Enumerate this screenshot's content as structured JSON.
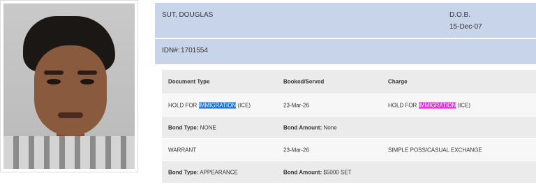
{
  "person": {
    "name": "SUT, DOUGLAS",
    "dob_label": "D.O.B.",
    "dob_value": "15-Dec-07",
    "idn_label": "IDN#:",
    "idn_value": "1701554"
  },
  "table": {
    "headers": {
      "doc_type": "Document Type",
      "booked": "Booked/Served",
      "charge": "Charge"
    },
    "records": [
      {
        "doc_pre": "HOLD FOR ",
        "doc_hl": "IMMIGRATION",
        "doc_post": " (ICE)",
        "booked": "23-Mar-26",
        "charge_pre": "HOLD FOR ",
        "charge_hl": "IMMIGRATION",
        "charge_post": " (ICE)",
        "bond_type_label": "Bond Type:",
        "bond_type_value": " NONE",
        "bond_amount_label": "Bond Amount:",
        "bond_amount_value": " None"
      },
      {
        "doc": "WARRANT",
        "booked": "23-Mar-26",
        "charge": "SIMPLE POSS/CASUAL EXCHANGE",
        "bond_type_label": "Bond Type:",
        "bond_type_value": " APPEARANCE",
        "bond_amount_label": "Bond Amount:",
        "bond_amount_value": " $5000 SET"
      }
    ]
  },
  "colors": {
    "header_bg": "#c8d4ea",
    "highlight_blue": "#1a6fd0",
    "highlight_pink": "#e22be0"
  }
}
